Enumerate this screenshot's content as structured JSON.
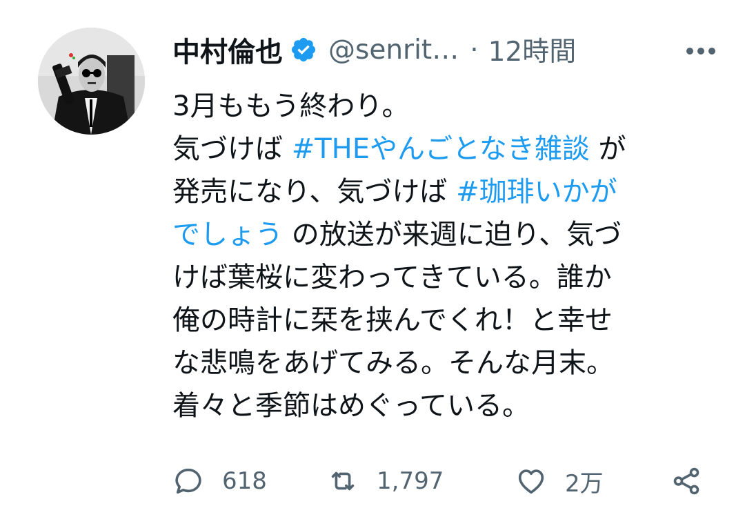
{
  "author": {
    "name": "中村倫也",
    "handle": "@senrit…",
    "separator": "·",
    "time": "12時間"
  },
  "tweet": {
    "lines": [
      [
        {
          "t": "3月ももう終わり。"
        }
      ],
      [
        {
          "t": "気づけば "
        },
        {
          "t": "#THEやんごとなき雑談",
          "tag": true
        },
        {
          "t": " が"
        }
      ],
      [
        {
          "t": "発売になり、気づけば "
        },
        {
          "t": "#珈琲いかが",
          "tag": true
        }
      ],
      [
        {
          "t": "でしょう",
          "tag": true
        },
        {
          "t": " の放送が来週に迫り、気づ"
        }
      ],
      [
        {
          "t": "けば葉桜に変わってきている。誰か"
        }
      ],
      [
        {
          "t": "俺の時計に栞を挟んでくれ！と幸せ"
        }
      ],
      [
        {
          "t": "な悲鳴をあげてみる。そんな月末。"
        }
      ],
      [
        {
          "t": "着々と季節はめぐっている。"
        }
      ]
    ]
  },
  "actions": {
    "replies": "618",
    "retweets": "1,797",
    "likes": "2万"
  },
  "colors": {
    "link": "#1d9bf0",
    "secondary_text": "#536471",
    "verified_badge": "#1d9bf0"
  },
  "icons": [
    "verified-badge-icon",
    "more-icon",
    "reply-icon",
    "retweet-icon",
    "like-icon",
    "share-icon"
  ]
}
